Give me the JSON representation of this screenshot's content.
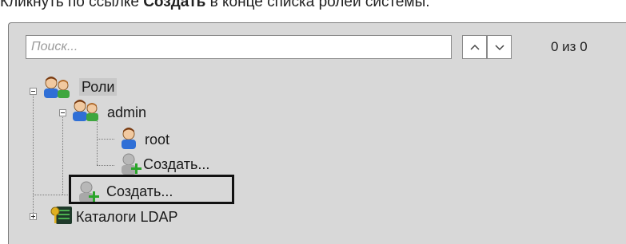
{
  "instruction": {
    "before": "Кликнуть по ссылке ",
    "bold": "Создать",
    "after": " в конце списка ролей системы."
  },
  "search": {
    "placeholder": "Поиск..."
  },
  "navigation": {
    "counter": "0 из 0"
  },
  "tree": {
    "root_label": "Роли",
    "admin_label": "admin",
    "root_user_label": "root",
    "create_user_label": "Создать...",
    "create_role_label": "Создать...",
    "ldap_label": "Каталоги LDAP"
  },
  "colors": {
    "panel_bg": "#d8d8d8",
    "highlight": "#111111"
  },
  "icons": [
    "users-icon",
    "user-icon",
    "add-user-icon",
    "ldap-catalog-icon",
    "chevron-up-icon",
    "chevron-down-icon"
  ]
}
